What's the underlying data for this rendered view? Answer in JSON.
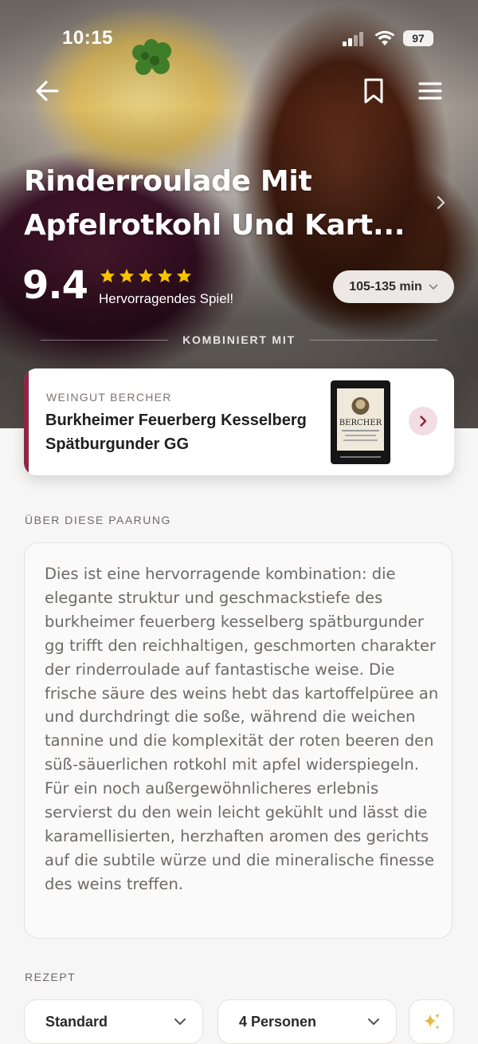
{
  "status_bar": {
    "time": "10:15",
    "battery": "97"
  },
  "dish": {
    "title_line1": "Rinderroulade Mit",
    "title_line2": "Apfelrotkohl Und Kart...",
    "score": "9.4",
    "stars": 5,
    "rating_label": "Hervorragendes Spiel!",
    "time_range": "105-135 min"
  },
  "pairing": {
    "divider_label": "KOMBINIERT MIT",
    "producer": "WEINGUT BERCHER",
    "wine_name": "Burkheimer Feuerberg Kesselberg Spätburgunder GG",
    "bottle_label": "BERCHER",
    "accent_color": "#8f2443"
  },
  "about": {
    "label": "ÜBER DIESE PAARUNG",
    "text": "Dies ist eine hervorragende kombination: die elegante struktur und geschmackstiefe des burkheimer feuerberg kesselberg spätburgunder gg trifft den reichhaltigen, geschmorten charakter der rinderroulade auf fantastische weise. Die frische säure des weins hebt das kartoffelpüree an und durchdringt die soße, während die weichen tannine und die komplexität der roten beeren den süß-säuerlichen rotkohl mit apfel widerspiegeln. Für ein noch außergewöhnlicheres erlebnis servierst du den wein leicht gekühlt und lässt die karamellisierten, herzhaften aromen des gerichts auf die subtile würze und die mineralische finesse des weins treffen."
  },
  "recipe": {
    "label": "REZEPT",
    "variant": "Standard",
    "servings": "4 Personen"
  },
  "colors": {
    "star": "#f7c300",
    "sparkle": "#e8b84a",
    "accent": "#8f2443"
  }
}
